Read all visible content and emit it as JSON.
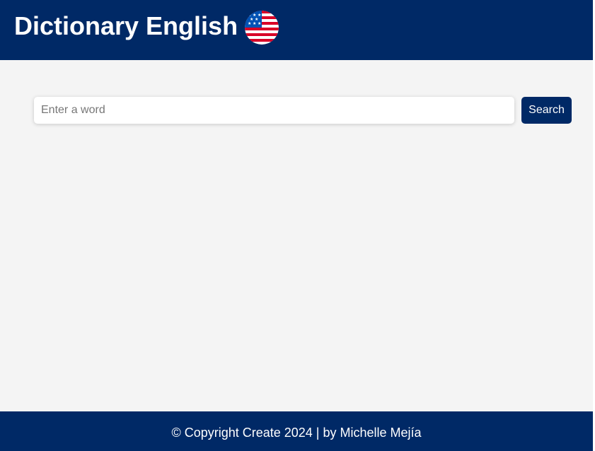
{
  "header": {
    "title": "Dictionary English",
    "flag_icon": "us-flag-icon"
  },
  "search": {
    "placeholder": "Enter a word",
    "value": "",
    "button_label": "Search"
  },
  "footer": {
    "text": "© Copyright Create 2024 | by Michelle Mejía"
  },
  "colors": {
    "header_bg": "#002966",
    "page_bg": "#f4f4f4",
    "button_bg": "#002966",
    "text_light": "#ffffff"
  }
}
